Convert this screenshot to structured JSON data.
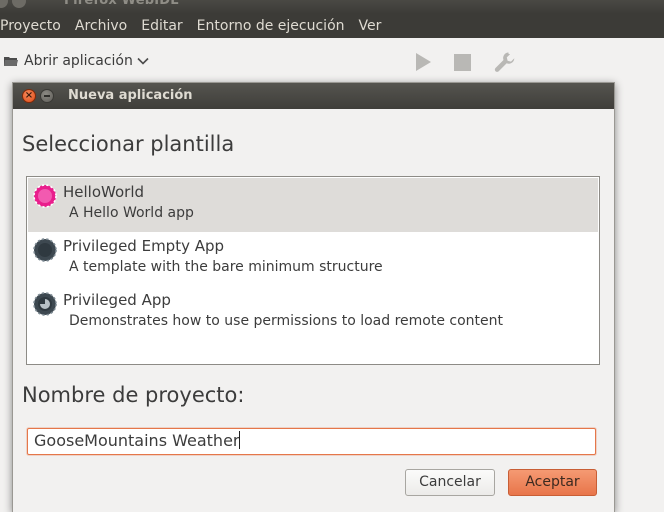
{
  "window": {
    "title": "Firefox WebIDE"
  },
  "menubar": {
    "items": [
      {
        "label": "Proyecto"
      },
      {
        "label": "Archivo"
      },
      {
        "label": "Editar"
      },
      {
        "label": "Entorno de ejecución"
      },
      {
        "label": "Ver"
      }
    ]
  },
  "toolbar": {
    "open_app_label": "Abrir aplicación",
    "icons": [
      "folder-icon",
      "chevron-down-icon",
      "play-icon",
      "stop-icon",
      "wrench-icon"
    ]
  },
  "dialog": {
    "title": "Nueva aplicación",
    "template_heading": "Seleccionar plantilla",
    "templates": [
      {
        "name": "HelloWorld",
        "description": "A Hello World app",
        "icon": "hello-world-icon",
        "icon_color": "#e91e8c",
        "selected": true
      },
      {
        "name": "Privileged Empty App",
        "description": "A template with the bare minimum structure",
        "icon": "privileged-empty-icon",
        "icon_color": "#3d4850",
        "selected": false
      },
      {
        "name": "Privileged App",
        "description": "Demonstrates how to use permissions to load remote content",
        "icon": "privileged-app-icon",
        "icon_color": "#3d4850",
        "selected": false
      }
    ],
    "project_name_heading": "Nombre de proyecto:",
    "project_name_value": "GooseMountains Weather",
    "cancel_label": "Cancelar",
    "accept_label": "Aceptar"
  },
  "colors": {
    "accent": "#e8754a",
    "menubar_bg": "#3c3b37",
    "selected_row": "#dedcd9"
  }
}
